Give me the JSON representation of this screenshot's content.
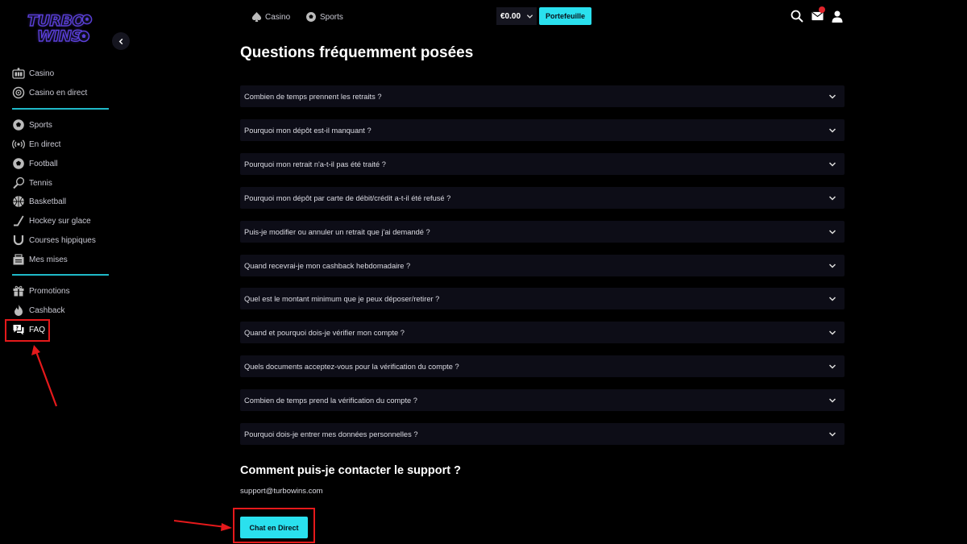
{
  "brand": {
    "logo_line1": "TURBO",
    "logo_line2": "WINS"
  },
  "colors": {
    "accent": "#2ae0ee",
    "divider": "#1fb9c8",
    "panel": "#0d0d17",
    "annotation": "#e5191b",
    "badge": "#e0242b"
  },
  "sidebar": {
    "groups": [
      [
        {
          "label": "Casino",
          "icon": "casino-icon"
        },
        {
          "label": "Casino en direct",
          "icon": "roulette-icon"
        }
      ],
      [
        {
          "label": "Sports",
          "icon": "soccer-ball-icon"
        },
        {
          "label": "En direct",
          "icon": "live-broadcast-icon"
        },
        {
          "label": "Football",
          "icon": "football-icon"
        },
        {
          "label": "Tennis",
          "icon": "tennis-icon"
        },
        {
          "label": "Basketball",
          "icon": "basketball-icon"
        },
        {
          "label": "Hockey sur glace",
          "icon": "hockey-stick-icon"
        },
        {
          "label": "Courses hippiques",
          "icon": "horseshoe-icon"
        },
        {
          "label": "Mes mises",
          "icon": "bets-ticket-icon"
        }
      ],
      [
        {
          "label": "Promotions",
          "icon": "gift-icon"
        },
        {
          "label": "Cashback",
          "icon": "flame-icon"
        },
        {
          "label": "FAQ",
          "icon": "faq-chat-icon"
        }
      ]
    ]
  },
  "topbar": {
    "nav": [
      {
        "label": "Casino",
        "icon": "spade-icon"
      },
      {
        "label": "Sports",
        "icon": "soccer-ball-icon"
      }
    ],
    "balance": "€0.00",
    "wallet_label": "Portefeuille",
    "icons": [
      "search-icon",
      "mail-icon",
      "user-icon"
    ]
  },
  "main": {
    "title": "Questions fréquemment posées",
    "faq": [
      "Combien de temps prennent les retraits ?",
      "Pourquoi mon dépôt est-il manquant ?",
      "Pourquoi mon retrait n'a-t-il pas été traité ?",
      "Pourquoi mon dépôt par carte de débit/crédit a-t-il été refusé ?",
      "Puis-je modifier ou annuler un retrait que j'ai demandé ?",
      "Quand recevrai-je mon cashback hebdomadaire ?",
      "Quel est le montant minimum que je peux déposer/retirer ?",
      "Quand et pourquoi dois-je vérifier mon compte ?",
      "Quels documents acceptez-vous pour la vérification du compte ?",
      "Combien de temps prend la vérification du compte ?",
      "Pourquoi dois-je entrer mes données personnelles ?"
    ],
    "support_title": "Comment puis-je contacter le support ?",
    "support_email": "support@turbowins.com",
    "chat_label": "Chat en Direct"
  }
}
